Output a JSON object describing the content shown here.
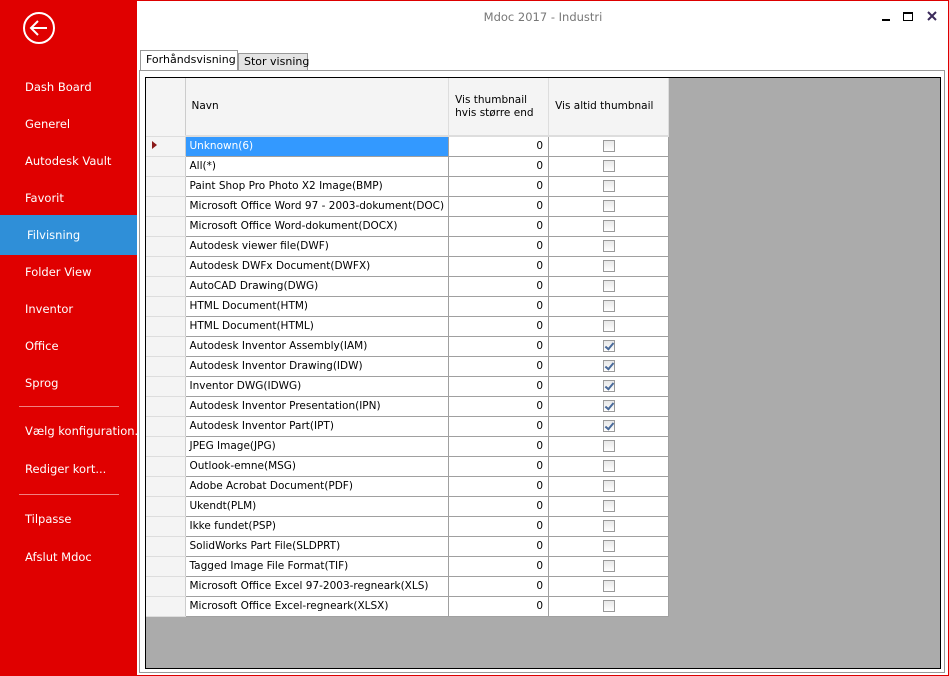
{
  "window": {
    "title": "Mdoc 2017 - Industri",
    "buttons": [
      "minimize",
      "maximize",
      "close"
    ]
  },
  "sidebar": {
    "back_icon": "back-arrow-icon",
    "items": [
      {
        "label": "Dash Board",
        "active": false
      },
      {
        "label": "Generel",
        "active": false
      },
      {
        "label": "Autodesk Vault",
        "active": false
      },
      {
        "label": "Favorit",
        "active": false
      },
      {
        "label": "Filvisning",
        "active": true
      },
      {
        "label": "Folder View",
        "active": false
      },
      {
        "label": "Inventor",
        "active": false
      },
      {
        "label": "Office",
        "active": false
      },
      {
        "label": "Sprog",
        "active": false
      },
      {
        "label": "Vælg konfiguration...",
        "active": false
      },
      {
        "label": "Rediger kort...",
        "active": false
      },
      {
        "label": "Tilpasse",
        "active": false
      },
      {
        "label": "Afslut Mdoc",
        "active": false
      }
    ]
  },
  "tabs": [
    {
      "label": "Forhåndsvisning",
      "active": true
    },
    {
      "label": "Stor visning",
      "active": false
    }
  ],
  "grid": {
    "columns": [
      "Navn",
      "Vis thumbnail hvis større end",
      "Vis altid thumbnail"
    ],
    "rows": [
      {
        "name": "Unknown(6)",
        "size": "0",
        "always": false,
        "selected": true
      },
      {
        "name": "All(*)",
        "size": "0",
        "always": false
      },
      {
        "name": "Paint Shop Pro Photo X2 Image(BMP)",
        "size": "0",
        "always": false
      },
      {
        "name": "Microsoft Office Word 97 - 2003-dokument(DOC)",
        "size": "0",
        "always": false
      },
      {
        "name": "Microsoft Office Word-dokument(DOCX)",
        "size": "0",
        "always": false
      },
      {
        "name": "Autodesk viewer file(DWF)",
        "size": "0",
        "always": false
      },
      {
        "name": "Autodesk DWFx Document(DWFX)",
        "size": "0",
        "always": false
      },
      {
        "name": "AutoCAD Drawing(DWG)",
        "size": "0",
        "always": false
      },
      {
        "name": "HTML Document(HTM)",
        "size": "0",
        "always": false
      },
      {
        "name": "HTML Document(HTML)",
        "size": "0",
        "always": false
      },
      {
        "name": "Autodesk Inventor Assembly(IAM)",
        "size": "0",
        "always": true
      },
      {
        "name": "Autodesk Inventor Drawing(IDW)",
        "size": "0",
        "always": true
      },
      {
        "name": "Inventor DWG(IDWG)",
        "size": "0",
        "always": true
      },
      {
        "name": "Autodesk Inventor Presentation(IPN)",
        "size": "0",
        "always": true
      },
      {
        "name": "Autodesk Inventor Part(IPT)",
        "size": "0",
        "always": true
      },
      {
        "name": "JPEG Image(JPG)",
        "size": "0",
        "always": false
      },
      {
        "name": "Outlook-emne(MSG)",
        "size": "0",
        "always": false
      },
      {
        "name": "Adobe Acrobat Document(PDF)",
        "size": "0",
        "always": false
      },
      {
        "name": "Ukendt(PLM)",
        "size": "0",
        "always": false
      },
      {
        "name": "Ikke fundet(PSP)",
        "size": "0",
        "always": false
      },
      {
        "name": "SolidWorks Part File(SLDPRT)",
        "size": "0",
        "always": false
      },
      {
        "name": "Tagged Image File Format(TIF)",
        "size": "0",
        "always": false
      },
      {
        "name": "Microsoft Office Excel 97-2003-regneark(XLS)",
        "size": "0",
        "always": false
      },
      {
        "name": "Microsoft Office Excel-regneark(XLSX)",
        "size": "0",
        "always": false
      }
    ]
  }
}
